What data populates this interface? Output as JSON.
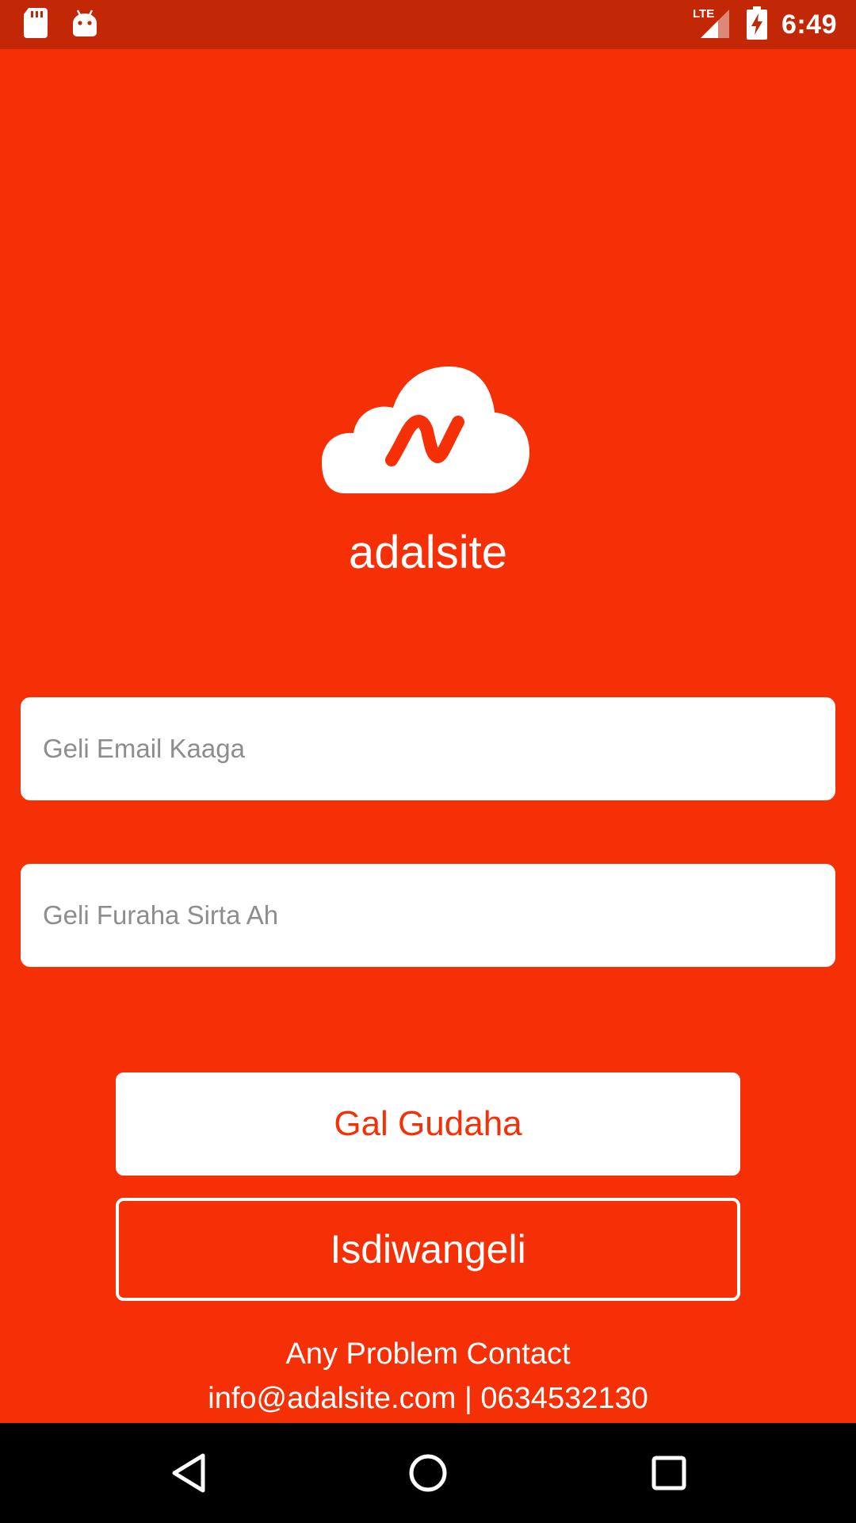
{
  "status_bar": {
    "network_label": "LTE",
    "time": "6:49",
    "icons": [
      "sd-card-icon",
      "android-icon",
      "signal-icon",
      "battery-charging-icon"
    ]
  },
  "app": {
    "brand_name": "adalsite",
    "logo_icon": "cloud-logo-icon",
    "email_placeholder": "Geli Email Kaaga",
    "password_placeholder": "Geli Furaha Sirta Ah",
    "login_label": "Gal Gudaha",
    "register_label": "Isdiwangeli",
    "contact_title": "Any Problem Contact",
    "contact_info": "info@adalsite.com | 0634532130"
  },
  "colors": {
    "primary": "#f53007",
    "status_bar": "#c22706",
    "white": "#ffffff",
    "nav_bar": "#000000"
  },
  "nav_bar": {
    "icons": [
      "back-icon",
      "home-icon",
      "recents-icon"
    ]
  }
}
